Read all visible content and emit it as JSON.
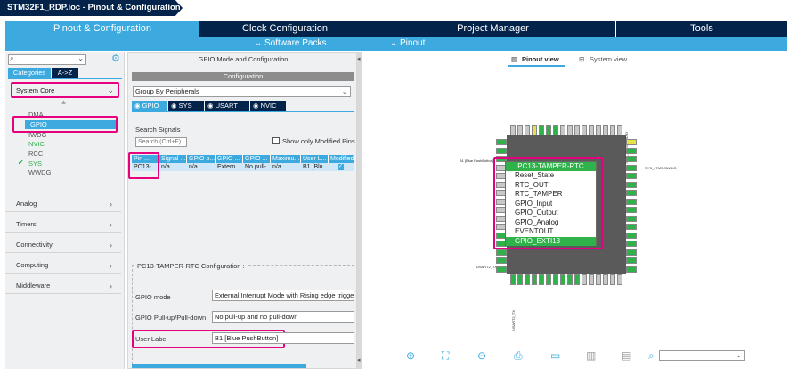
{
  "breadcrumb": {
    "title": "STM32F1_RDP.ioc - Pinout & Configuration"
  },
  "tabs": [
    "Pinout & Configuration",
    "Clock Configuration",
    "Project Manager",
    "Tools"
  ],
  "subtabs": {
    "software_packs": "Software Packs",
    "pinout": "Pinout"
  },
  "left": {
    "cat_tabs": [
      "Categories",
      "A->Z"
    ],
    "system_core": "System Core",
    "system_core_items": [
      "DMA",
      "GPIO",
      "IWDG",
      "NVIC",
      "RCC",
      "SYS",
      "WWDG"
    ],
    "categories": [
      "Analog",
      "Timers",
      "Connectivity",
      "Computing",
      "Middleware"
    ]
  },
  "middle": {
    "title": "GPIO Mode and Configuration",
    "config_header": "Configuration",
    "group_by": "Group By Peripherals",
    "mode_tabs": [
      "GPIO",
      "SYS",
      "USART",
      "NVIC"
    ],
    "search_label": "Search Signals",
    "search_placeholder": "Search (Ctrl+F)",
    "show_modified": "Show only Modified Pins",
    "table": {
      "headers": [
        "Pin ...",
        "Signal ...",
        "GPIO o...",
        "GPIO ...",
        "GPIO ...",
        "Maximu...",
        "User L...",
        "Modified"
      ],
      "row": [
        "PC13-...",
        "n/a",
        "n/a",
        "Extern...",
        "No pull-...",
        "n/a",
        "B1 [Blu...",
        ""
      ]
    },
    "config_title": "PC13-TAMPER-RTC Configuration :",
    "fields": [
      {
        "label": "GPIO mode",
        "value": "External Interrupt Mode with Rising edge trigger d"
      },
      {
        "label": "GPIO Pull-up/Pull-down",
        "value": "No pull-up and no pull-down"
      },
      {
        "label": "User Label",
        "value": "B1 [Blue PushButton]"
      }
    ]
  },
  "right": {
    "pinout_view": "Pinout view",
    "system_view": "System view",
    "chip_pin_label": "B1 [Blue PushButton]",
    "right_label": "SYS_JTMS-SWDIO",
    "bottom_label": "USART2_TX",
    "context_menu": {
      "header": "PC13-TAMPER-RTC",
      "items": [
        "Reset_State",
        "RTC_OUT",
        "RTC_TAMPER",
        "GPIO_Input",
        "GPIO_Output",
        "GPIO_Analog",
        "EVENTOUT",
        "GPIO_EXTI13"
      ],
      "selected": "GPIO_EXTI13"
    }
  },
  "colors": {
    "navy": "#03234b",
    "accent": "#3ca9df",
    "highlight": "#e6007e",
    "pin_green": "#2fb24a"
  }
}
